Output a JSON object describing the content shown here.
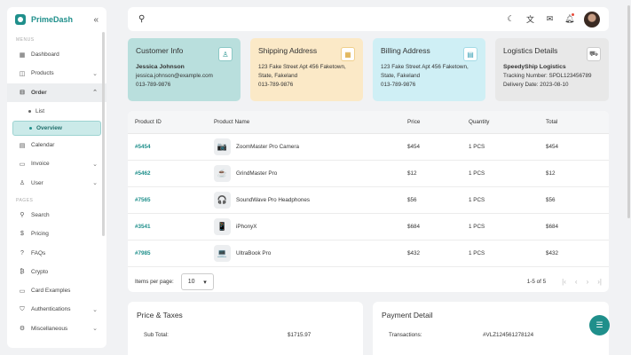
{
  "brand": {
    "name": "PrimeDash"
  },
  "sidebar": {
    "menus_label": "MENUS",
    "pages_label": "PAGES",
    "menus": [
      {
        "label": "Dashboard",
        "icon": "grid-icon",
        "glyph": "▦",
        "chev": ""
      },
      {
        "label": "Products",
        "icon": "box-icon",
        "glyph": "◫",
        "chev": "⌄"
      },
      {
        "label": "Order",
        "icon": "cart-icon",
        "glyph": "⊟",
        "chev": "⌃"
      }
    ],
    "order_sub": [
      {
        "label": "List"
      },
      {
        "label": "Overview"
      }
    ],
    "menus_after": [
      {
        "label": "Calendar",
        "icon": "calendar-icon",
        "glyph": "▤",
        "chev": ""
      },
      {
        "label": "Invoice",
        "icon": "invoice-icon",
        "glyph": "▭",
        "chev": "⌄"
      },
      {
        "label": "User",
        "icon": "user-icon",
        "glyph": "♙",
        "chev": "⌄"
      }
    ],
    "pages": [
      {
        "label": "Search",
        "icon": "search-icon",
        "glyph": "⚲",
        "chev": ""
      },
      {
        "label": "Pricing",
        "icon": "dollar-icon",
        "glyph": "$",
        "chev": ""
      },
      {
        "label": "FAQs",
        "icon": "help-icon",
        "glyph": "?",
        "chev": ""
      },
      {
        "label": "Crypto",
        "icon": "bitcoin-icon",
        "glyph": "₿",
        "chev": ""
      },
      {
        "label": "Card Examples",
        "icon": "card-icon",
        "glyph": "▭",
        "chev": ""
      },
      {
        "label": "Authentications",
        "icon": "shield-icon",
        "glyph": "⛉",
        "chev": "⌄"
      },
      {
        "label": "Miscellaneous",
        "icon": "settings-icon",
        "glyph": "⚙",
        "chev": "⌄"
      }
    ]
  },
  "header": {
    "icons": [
      "search-icon",
      "moon-icon",
      "translate-icon",
      "mail-icon",
      "bell-icon",
      "avatar"
    ]
  },
  "cards": {
    "customer": {
      "title": "Customer Info",
      "name": "Jessica Johnson",
      "email": "jessica.johnson@example.com",
      "phone": "013-789-9876"
    },
    "shipping": {
      "title": "Shipping Address",
      "line1": "123 Fake Street Apt 456 Faketown,",
      "line2": "State, Fakeland",
      "phone": "013-789-9876"
    },
    "billing": {
      "title": "Billing Address",
      "line1": "123 Fake Street Apt 456 Faketown,",
      "line2": "State, Fakeland",
      "phone": "013-789-9876"
    },
    "logistics": {
      "title": "Logistics Details",
      "company": "SpeedyShip Logistics",
      "tracking": "Tracking Number: SPDL123456789",
      "delivery": "Delivery Date: 2023-08-10"
    }
  },
  "table": {
    "headers": [
      "Product ID",
      "Product Name",
      "Price",
      "Quantity",
      "Total"
    ],
    "rows": [
      {
        "id": "#5454",
        "name": "ZoomMaster Pro Camera",
        "price": "$454",
        "qty": "1 PCS",
        "total": "$454",
        "thumb": "📷"
      },
      {
        "id": "#5462",
        "name": "GrindMaster Pro",
        "price": "$12",
        "qty": "1 PCS",
        "total": "$12",
        "thumb": "☕"
      },
      {
        "id": "#7565",
        "name": "SoundWave Pro Headphones",
        "price": "$56",
        "qty": "1 PCS",
        "total": "$56",
        "thumb": "🎧"
      },
      {
        "id": "#3541",
        "name": "iPhonyX",
        "price": "$684",
        "qty": "1 PCS",
        "total": "$684",
        "thumb": "📱"
      },
      {
        "id": "#7985",
        "name": "UltraBook Pro",
        "price": "$432",
        "qty": "1 PCS",
        "total": "$432",
        "thumb": "💻"
      }
    ],
    "footer": {
      "per_page_label": "Items per page:",
      "per_page_value": "10",
      "range": "1-5 of 5"
    }
  },
  "price_taxes": {
    "title": "Price & Taxes",
    "subtotal_label": "Sub Total:",
    "subtotal_value": "$1715.97"
  },
  "payment": {
    "title": "Payment Detail",
    "transactions_label": "Transactions:",
    "transactions_value": "#VLZ124561278124"
  },
  "colors": {
    "accent": "#1f8f8b"
  }
}
